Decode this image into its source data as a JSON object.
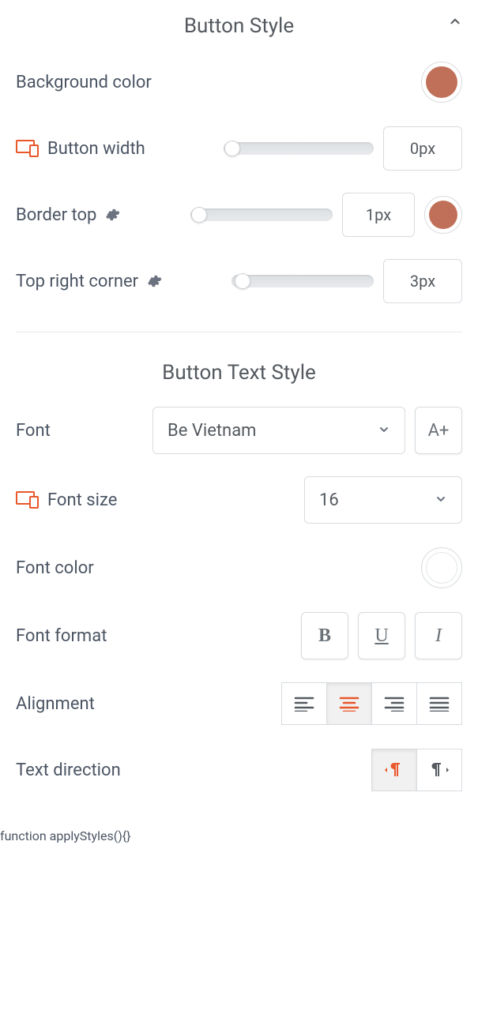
{
  "button_style": {
    "title": "Button Style",
    "background_color": {
      "label": "Background color",
      "value": "#c07058"
    },
    "button_width": {
      "label": "Button width",
      "value": "0px"
    },
    "border_top": {
      "label": "Border top",
      "value": "1px",
      "color": "#c07058"
    },
    "top_right_corner": {
      "label": "Top right corner",
      "value": "3px"
    }
  },
  "button_text_style": {
    "title": "Button Text Style",
    "font": {
      "label": "Font",
      "value": "Be Vietnam",
      "aplus": "A+"
    },
    "font_size": {
      "label": "Font size",
      "value": "16"
    },
    "font_color": {
      "label": "Font color",
      "value": "#ffffff"
    },
    "font_format": {
      "label": "Font format"
    },
    "alignment": {
      "label": "Alignment"
    },
    "text_direction": {
      "label": "Text direction"
    }
  }
}
